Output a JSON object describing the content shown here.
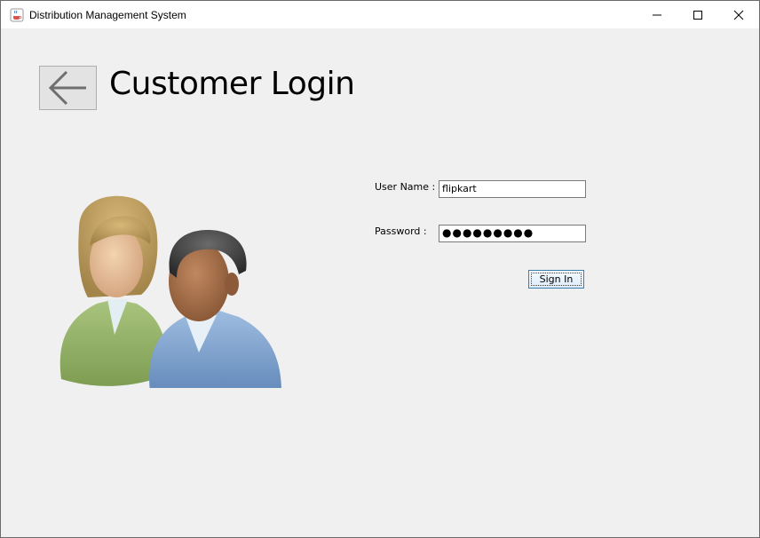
{
  "window": {
    "title": "Distribution Management System"
  },
  "page": {
    "heading": "Customer Login"
  },
  "form": {
    "username_label": "User Name :",
    "username_value": "flipkart",
    "password_label": "Password :",
    "password_masked": "●●●●●●●●●",
    "signin_label": "Sign In"
  },
  "icons": {
    "app": "java-cup-icon",
    "back": "back-arrow-icon",
    "illustration": "users-icon"
  }
}
